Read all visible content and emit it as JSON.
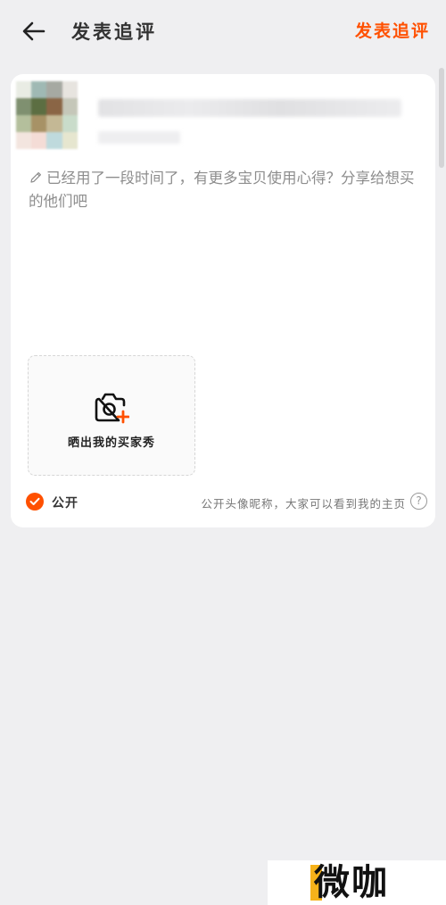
{
  "header": {
    "title": "发表追评",
    "publish_label": "发表追评"
  },
  "comment": {
    "placeholder": "已经用了一段时间了，有更多宝贝使用心得？分享给想买的他们吧"
  },
  "photo": {
    "label": "晒出我的买家秀"
  },
  "visibility": {
    "label": "公开",
    "hint": "公开头像昵称，大家可以看到我的主页",
    "help_symbol": "?"
  },
  "watermark": {
    "text": "微咖"
  },
  "colors": {
    "accent": "#ff5000",
    "page_bg": "#efeff1",
    "card_bg": "#ffffff"
  }
}
